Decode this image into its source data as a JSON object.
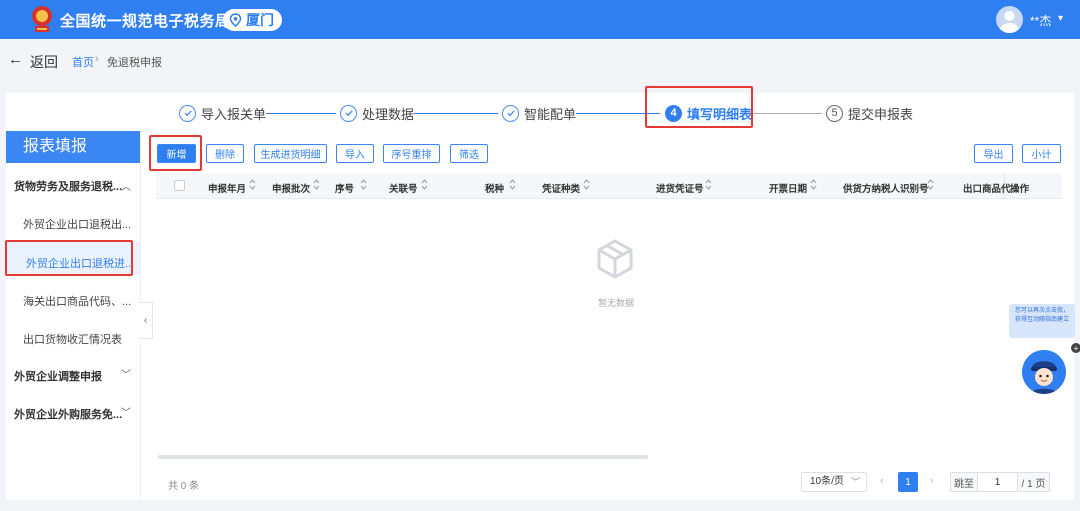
{
  "header": {
    "site_title": "全国统一规范电子税务局",
    "city": "厦门",
    "user_name": "**杰",
    "colors": {
      "brand": "#2f7ff0"
    }
  },
  "nav": {
    "back_label": "返回",
    "breadcrumb": [
      "首页",
      "免退税申报"
    ],
    "breadcrumb_sep": "›"
  },
  "steps": [
    {
      "label": "导入报关单",
      "state": "done"
    },
    {
      "label": "处理数据",
      "state": "done"
    },
    {
      "label": "智能配单",
      "state": "done"
    },
    {
      "label": "填写明细表",
      "state": "active",
      "number": "4"
    },
    {
      "label": "提交申报表",
      "state": "pending",
      "number": "5"
    }
  ],
  "sidebar": {
    "title": "报表填报",
    "groups": [
      {
        "label": "货物劳务及服务退税...",
        "expanded": true,
        "items": [
          {
            "label": "外贸企业出口退税出..."
          },
          {
            "label": "外贸企业出口退税进...",
            "active": true
          },
          {
            "label": "海关出口商品代码、..."
          },
          {
            "label": "出口货物收汇情况表"
          }
        ]
      },
      {
        "label": "外贸企业调整申报",
        "expanded": false
      },
      {
        "label": "外贸企业外购服务免...",
        "expanded": false
      }
    ]
  },
  "toolbar": {
    "add": "新增",
    "delete": "删除",
    "generate": "生成进货明细",
    "import": "导入",
    "reorder": "序号重排",
    "filter": "筛选",
    "export": "导出",
    "subtotal": "小计"
  },
  "table": {
    "columns": [
      "申报年月",
      "申报批次",
      "序号",
      "关联号",
      "税种",
      "凭证种类",
      "进货凭证号",
      "开票日期",
      "供货方纳税人识别号",
      "出口商品代",
      "操作"
    ],
    "empty_text": "暂无数据"
  },
  "pagination": {
    "total": "共 0 条",
    "page_size": "10条/页",
    "current_page": "1",
    "jump_label": "跳至",
    "jump_value": "1",
    "total_pages": "/ 1 页"
  },
  "assistant": {
    "bubble_text": "您可以再次点击我，获得互动随指南建立"
  }
}
